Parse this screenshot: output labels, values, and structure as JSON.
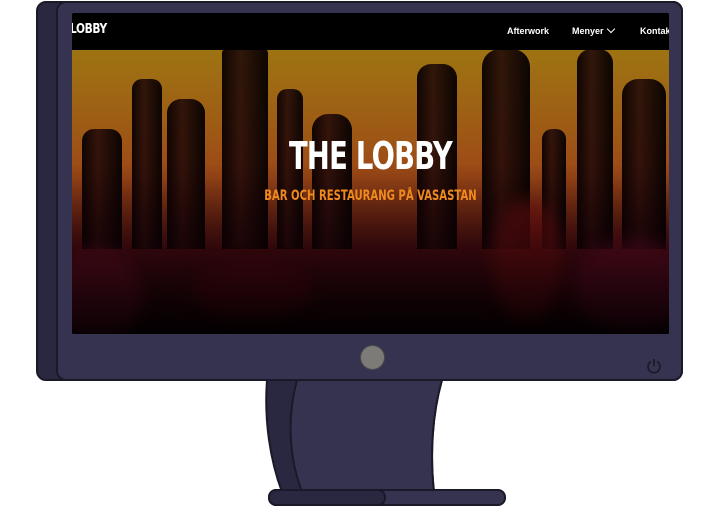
{
  "site": {
    "logo": "LOBBY",
    "nav": {
      "afterwork": "Afterwork",
      "menyer": "Menyer",
      "kontakt": "Kontakt"
    },
    "hero": {
      "title": "THE LOBBY",
      "subtitle": "BAR OCH RESTAURANG PÅ VASASTAN"
    }
  },
  "colors": {
    "nav_background": "#000000",
    "subtitle": "#f08a1e",
    "monitor_body": "#353350"
  },
  "icons": {
    "menu_chevron": "chevron-down-icon",
    "power": "power-icon"
  }
}
